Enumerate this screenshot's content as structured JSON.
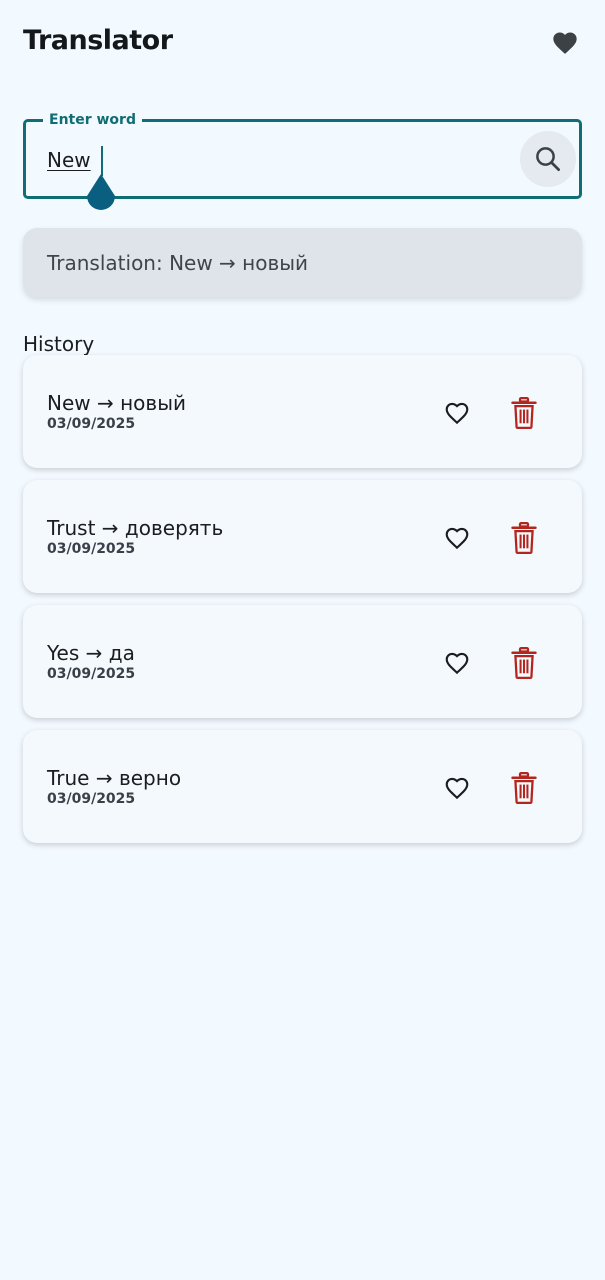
{
  "app": {
    "title": "Translator"
  },
  "search": {
    "label": "Enter word",
    "value": "New"
  },
  "translation": {
    "text": "Translation: New → новый"
  },
  "history": {
    "title": "History",
    "items": [
      {
        "text": "New → новый",
        "date": "03/09/2025"
      },
      {
        "text": "Trust → доверять",
        "date": "03/09/2025"
      },
      {
        "text": "Yes → да",
        "date": "03/09/2025"
      },
      {
        "text": "True → верно",
        "date": "03/09/2025"
      }
    ]
  },
  "icons": {
    "favorites": "heart-filled-icon",
    "search": "search-icon",
    "item_favorite": "heart-outline-icon",
    "item_delete": "trash-icon"
  },
  "colors": {
    "background": "#f2f9ff",
    "accent": "#0f6d73",
    "caret": "#0f6d73",
    "delete": "#b3261e",
    "card": "#dfe4ea"
  }
}
